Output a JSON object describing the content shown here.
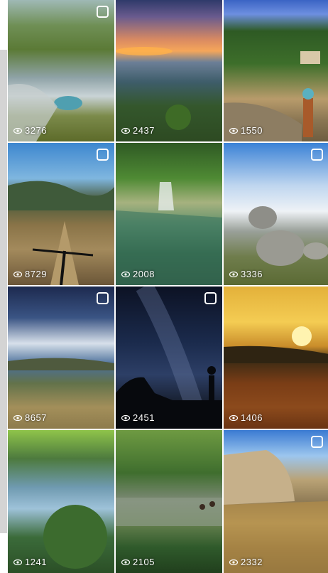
{
  "grid": {
    "tiles": [
      {
        "views": "3276",
        "multi": true,
        "icon": "eye-icon"
      },
      {
        "views": "2437",
        "multi": false,
        "icon": "eye-icon"
      },
      {
        "views": "1550",
        "multi": false,
        "icon": "eye-icon"
      },
      {
        "views": "8729",
        "multi": true,
        "icon": "eye-icon"
      },
      {
        "views": "2008",
        "multi": false,
        "icon": "eye-icon"
      },
      {
        "views": "3336",
        "multi": true,
        "icon": "eye-icon"
      },
      {
        "views": "8657",
        "multi": true,
        "icon": "eye-icon"
      },
      {
        "views": "2451",
        "multi": true,
        "icon": "eye-icon"
      },
      {
        "views": "1406",
        "multi": false,
        "icon": "eye-icon"
      },
      {
        "views": "1241",
        "multi": false,
        "icon": "eye-icon"
      },
      {
        "views": "2105",
        "multi": false,
        "icon": "eye-icon"
      },
      {
        "views": "2332",
        "multi": true,
        "icon": "eye-icon"
      }
    ]
  },
  "colors": {
    "overlay_text": "#ffffff",
    "rail": "#d4d4d4",
    "background": "#ffffff"
  }
}
